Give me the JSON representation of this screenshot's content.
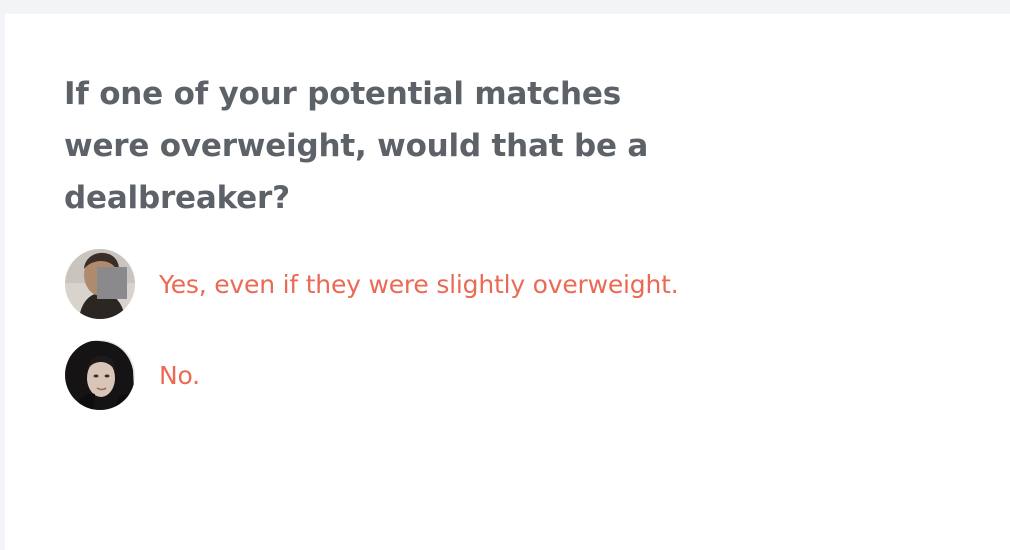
{
  "question": {
    "text": "If one of your potential matches were overweight, would that be a dealbreaker?"
  },
  "answers": [
    {
      "label": "Yes, even if they were slightly overweight.",
      "avatar_icon": "user-avatar-man"
    },
    {
      "label": "No.",
      "avatar_icon": "user-avatar-woman"
    }
  ],
  "colors": {
    "question_text": "#5d6269",
    "answer_text": "#eb6a55",
    "page_background": "#f3f4f7",
    "card_background": "#ffffff"
  }
}
